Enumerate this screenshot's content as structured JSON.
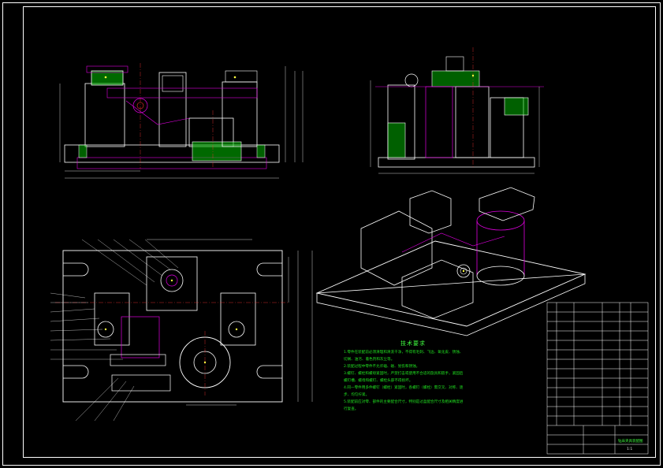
{
  "drawing": {
    "colors": {
      "background": "#000000",
      "outline": "#ffffff",
      "part_lines": "#e000e0",
      "hatch": "#00e000",
      "dimension": "#ffffff",
      "center_lines": "#ff3030",
      "fasteners": "#ffff40",
      "notes_text": "#20e020",
      "highlight_block": "#40c0ff"
    },
    "technical_notes": {
      "title": "技术要求",
      "lines": [
        "1.零件在装配前必须清理和清洗干净，不得有毛刺、飞边、氧化皮、锈蚀、",
        "切屑、油污、着色剂和灰尘等。",
        "2.装配过程中零件不允许磕、碰、划伤和锈蚀。",
        "3.螺钉、螺栓和螺母紧固时，严禁打击或使用不合适的旋具和扳手，紧固后",
        "螺钉槽、螺母和螺钉、螺栓头部不得损坏。",
        "4.同一零件用多件螺钉（螺栓）紧固时，各螺钉（螺栓）需交叉、对称、逐",
        "步、均匀拧紧。",
        "5.装配前应对零、部件的主要配合尺寸，特别是过盈配合尺寸及相关精度进",
        "行复查。"
      ]
    },
    "title_block": {
      "name_cell": "钻床夹具装配图",
      "scale_cell": "1:1"
    }
  }
}
